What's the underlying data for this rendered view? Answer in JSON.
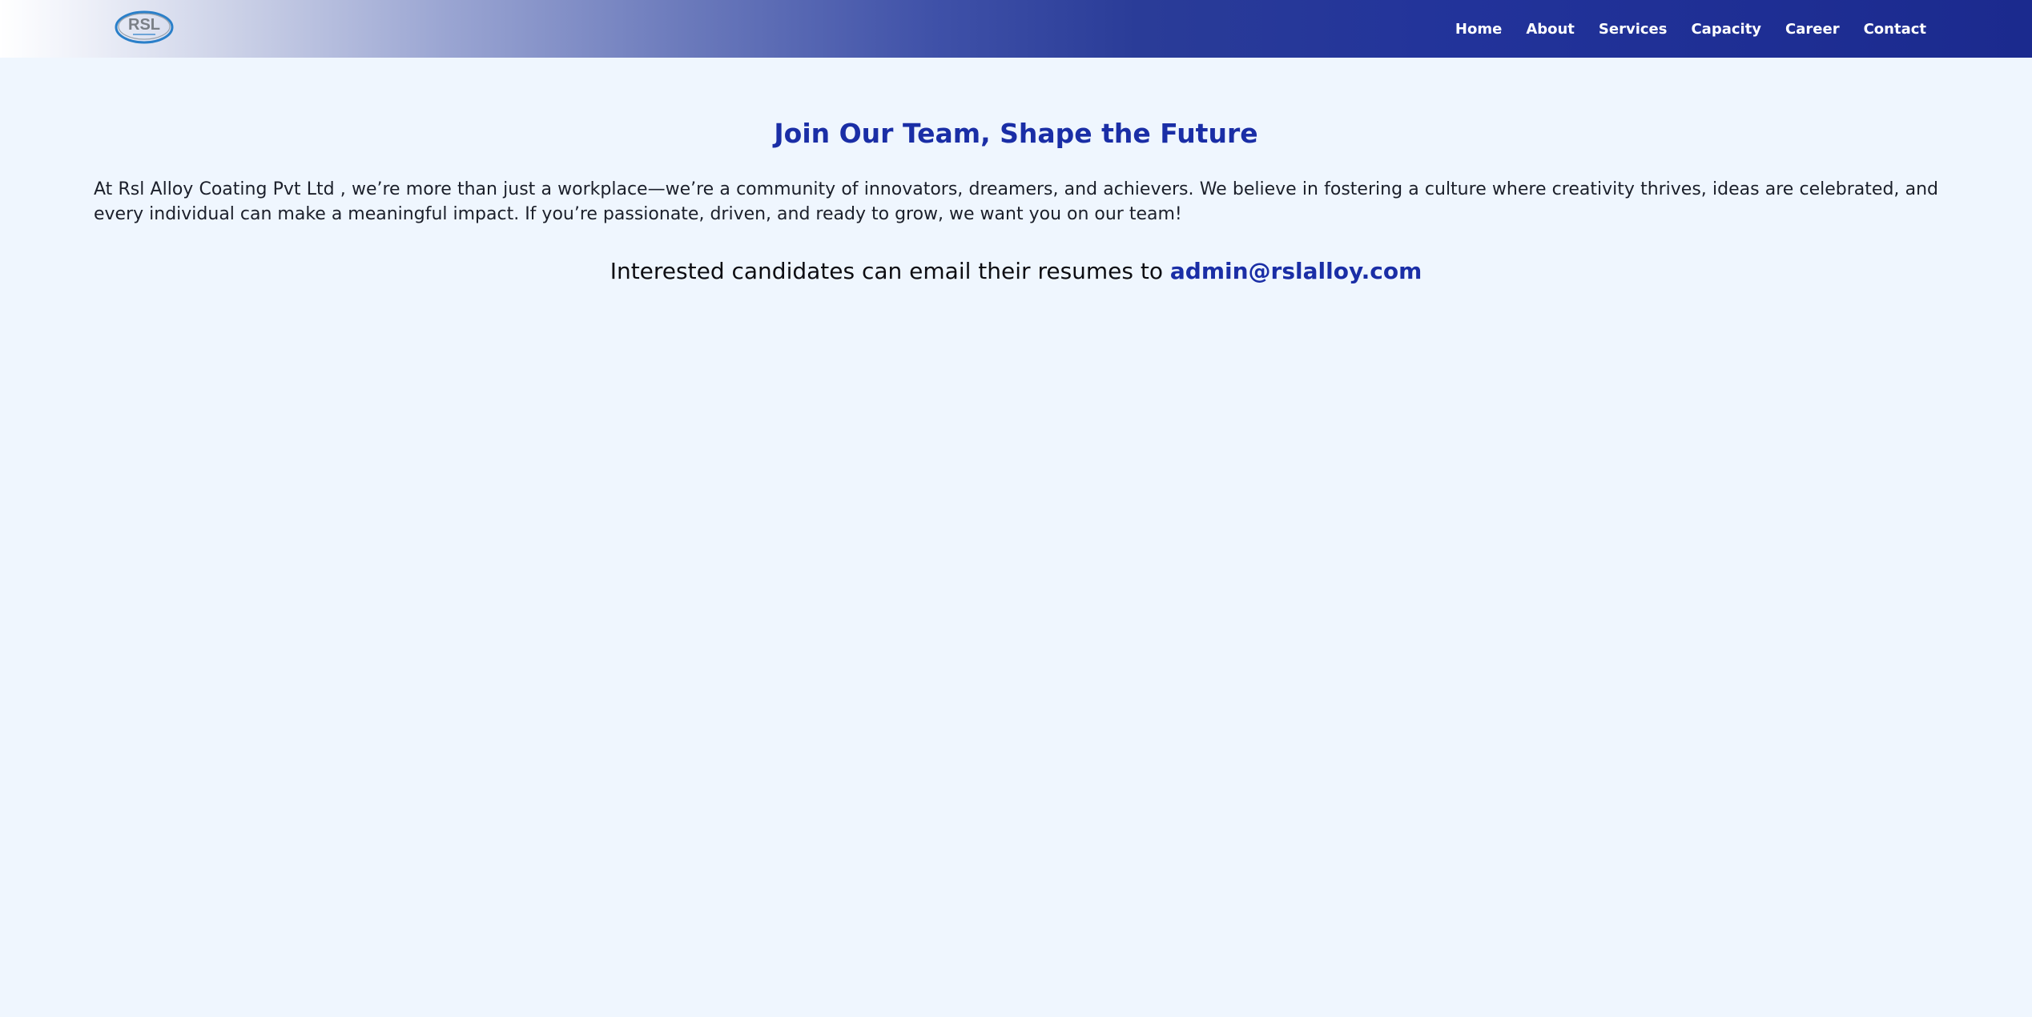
{
  "header": {
    "logo_text": "RSL",
    "nav": [
      {
        "label": "Home"
      },
      {
        "label": "About"
      },
      {
        "label": "Services"
      },
      {
        "label": "Capacity"
      },
      {
        "label": "Career"
      },
      {
        "label": "Contact"
      }
    ]
  },
  "main": {
    "title": "Join Our Team, Shape the Future",
    "intro": "At Rsl Alloy Coating Pvt Ltd , we’re more than just a workplace—we’re a community of innovators, dreamers, and achievers. We believe in fostering a culture where creativity thrives, ideas are celebrated, and every individual can make a meaningful impact. If you’re passionate, driven, and ready to grow, we want you on our team!",
    "cta_text": "Interested candidates can email their resumes to",
    "cta_email": "admin@rslalloy.com"
  },
  "colors": {
    "page_background": "#eff6fe",
    "accent": "#1a2ea6",
    "nav_dark": "#1b2a8e"
  }
}
